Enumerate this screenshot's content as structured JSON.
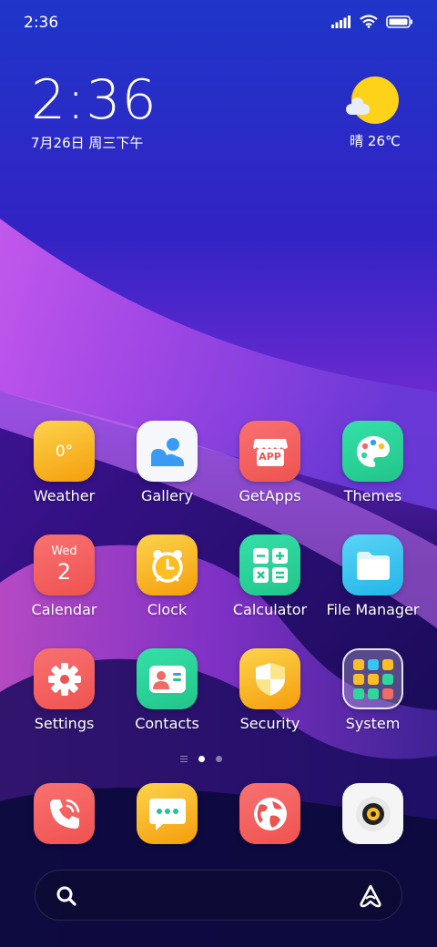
{
  "status_bar": {
    "time": "2:36"
  },
  "clock_widget": {
    "time": "2:36",
    "date": "7月26日 周三下午"
  },
  "weather_widget": {
    "condition": "晴",
    "temperature": "26℃",
    "text": "晴 26℃"
  },
  "apps": [
    {
      "label": "Weather",
      "icon": "weather-icon",
      "color": "#fbbf24",
      "badge": "0°"
    },
    {
      "label": "Gallery",
      "icon": "gallery-icon",
      "color": "#f5f7fa"
    },
    {
      "label": "GetApps",
      "icon": "getapps-icon",
      "color": "#f2645f",
      "badge": "APP"
    },
    {
      "label": "Themes",
      "icon": "themes-icon",
      "color": "#2fd79a"
    },
    {
      "label": "Calendar",
      "icon": "calendar-icon",
      "color": "#f06a66",
      "day": "Wed",
      "date": "2"
    },
    {
      "label": "Clock",
      "icon": "clock-icon",
      "color": "#fbbf24"
    },
    {
      "label": "Calculator",
      "icon": "calculator-icon",
      "color": "#2fd79a"
    },
    {
      "label": "File Manager",
      "icon": "folder-icon",
      "color": "#36c5f0"
    },
    {
      "label": "Settings",
      "icon": "settings-icon",
      "color": "#f06a66"
    },
    {
      "label": "Contacts",
      "icon": "contacts-icon",
      "color": "#2fd79a"
    },
    {
      "label": "Security",
      "icon": "security-icon",
      "color": "#fbbf24"
    },
    {
      "label": "System",
      "icon": "system-folder-icon",
      "color": "#ffffff"
    }
  ],
  "page_indicator": {
    "pages": 2,
    "active": 1
  },
  "dock": [
    {
      "icon": "phone-icon",
      "color": "#f06a66"
    },
    {
      "icon": "messages-icon",
      "color": "#fbbf24"
    },
    {
      "icon": "browser-icon",
      "color": "#f06a66"
    },
    {
      "icon": "music-icon",
      "color": "#f5f5f5"
    }
  ],
  "search_bar": {
    "left_icon": "search-icon",
    "right_icon": "assistant-icon"
  }
}
